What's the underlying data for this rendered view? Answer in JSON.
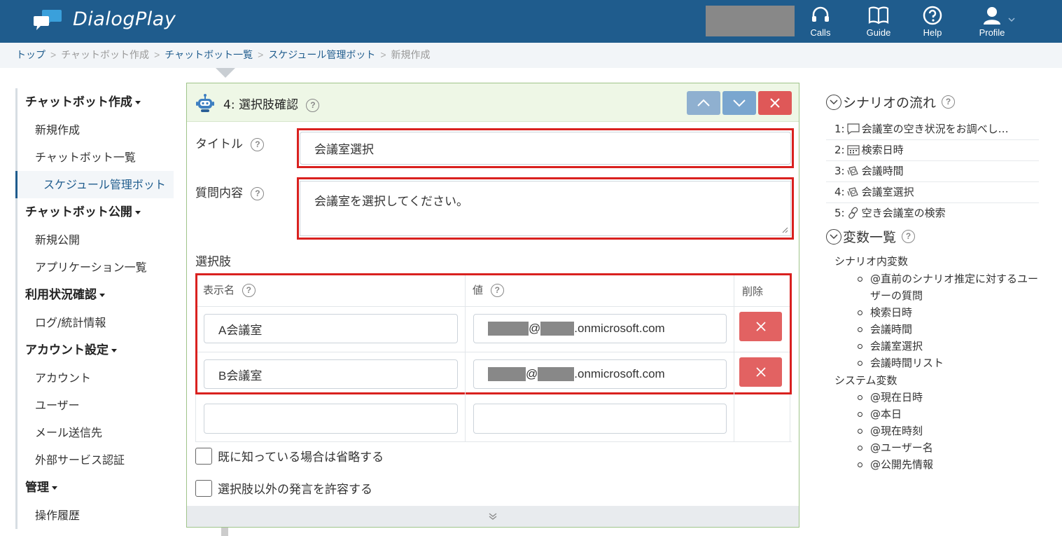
{
  "header": {
    "brand": "DialogPlay",
    "nav": [
      {
        "label": "Calls",
        "icon": "headset-icon"
      },
      {
        "label": "Guide",
        "icon": "book-icon"
      },
      {
        "label": "Help",
        "icon": "help-circle-icon"
      },
      {
        "label": "Profile",
        "icon": "user-icon"
      }
    ]
  },
  "breadcrumb": {
    "items": [
      "トップ",
      "チャットボット作成",
      "チャットボット一覧",
      "スケジュール管理ボット",
      "新規作成"
    ]
  },
  "sidebar": {
    "sections": [
      {
        "title": "チャットボット作成",
        "items": [
          "新規作成",
          "チャットボット一覧",
          "スケジュール管理ボット"
        ]
      },
      {
        "title": "チャットボット公開",
        "items": [
          "新規公開",
          "アプリケーション一覧"
        ]
      },
      {
        "title": "利用状況確認",
        "items": [
          "ログ/統計情報"
        ]
      },
      {
        "title": "アカウント設定",
        "items": [
          "アカウント",
          "ユーザー",
          "メール送信先",
          "外部サービス認証"
        ]
      },
      {
        "title": "管理",
        "items": [
          "操作履歴"
        ]
      }
    ]
  },
  "panel": {
    "step_title": "4: 選択肢確認",
    "title_label": "タイトル",
    "title_value": "会議室選択",
    "question_label": "質問内容",
    "question_value": "会議室を選択してください。",
    "choices_label": "選択肢",
    "col_display": "表示名",
    "col_value": "値",
    "col_delete": "削除",
    "rows": [
      {
        "display": "A会議室",
        "value_at": "@",
        "value_domain": ".onmicrosoft.com"
      },
      {
        "display": "B会議室",
        "value_at": "@",
        "value_domain": ".onmicrosoft.com"
      }
    ],
    "skip_if_known": "既に知っている場合は省略する",
    "allow_other": "選択肢以外の発言を許容する"
  },
  "scenario": {
    "title": "シナリオの流れ",
    "items": [
      {
        "num": "1:",
        "label": "会議室の空き状況をお調べし…",
        "icon": "speech-bubble-icon"
      },
      {
        "num": "2:",
        "label": "検索日時",
        "icon": "calendar-icon"
      },
      {
        "num": "3:",
        "label": "会議時間",
        "icon": "choice-icon"
      },
      {
        "num": "4:",
        "label": "会議室選択",
        "icon": "choice-icon"
      },
      {
        "num": "5:",
        "label": "空き会議室の検索",
        "icon": "link-icon"
      }
    ]
  },
  "variables": {
    "title": "変数一覧",
    "scenario_group": "シナリオ内変数",
    "scenario_vars": [
      "@直前のシナリオ推定に対するユーザーの質問",
      "検索日時",
      "会議時間",
      "会議室選択",
      "会議時間リスト"
    ],
    "system_group": "システム変数",
    "system_vars": [
      "@現在日時",
      "@本日",
      "@現在時刻",
      "@ユーザー名",
      "@公開先情報"
    ]
  }
}
